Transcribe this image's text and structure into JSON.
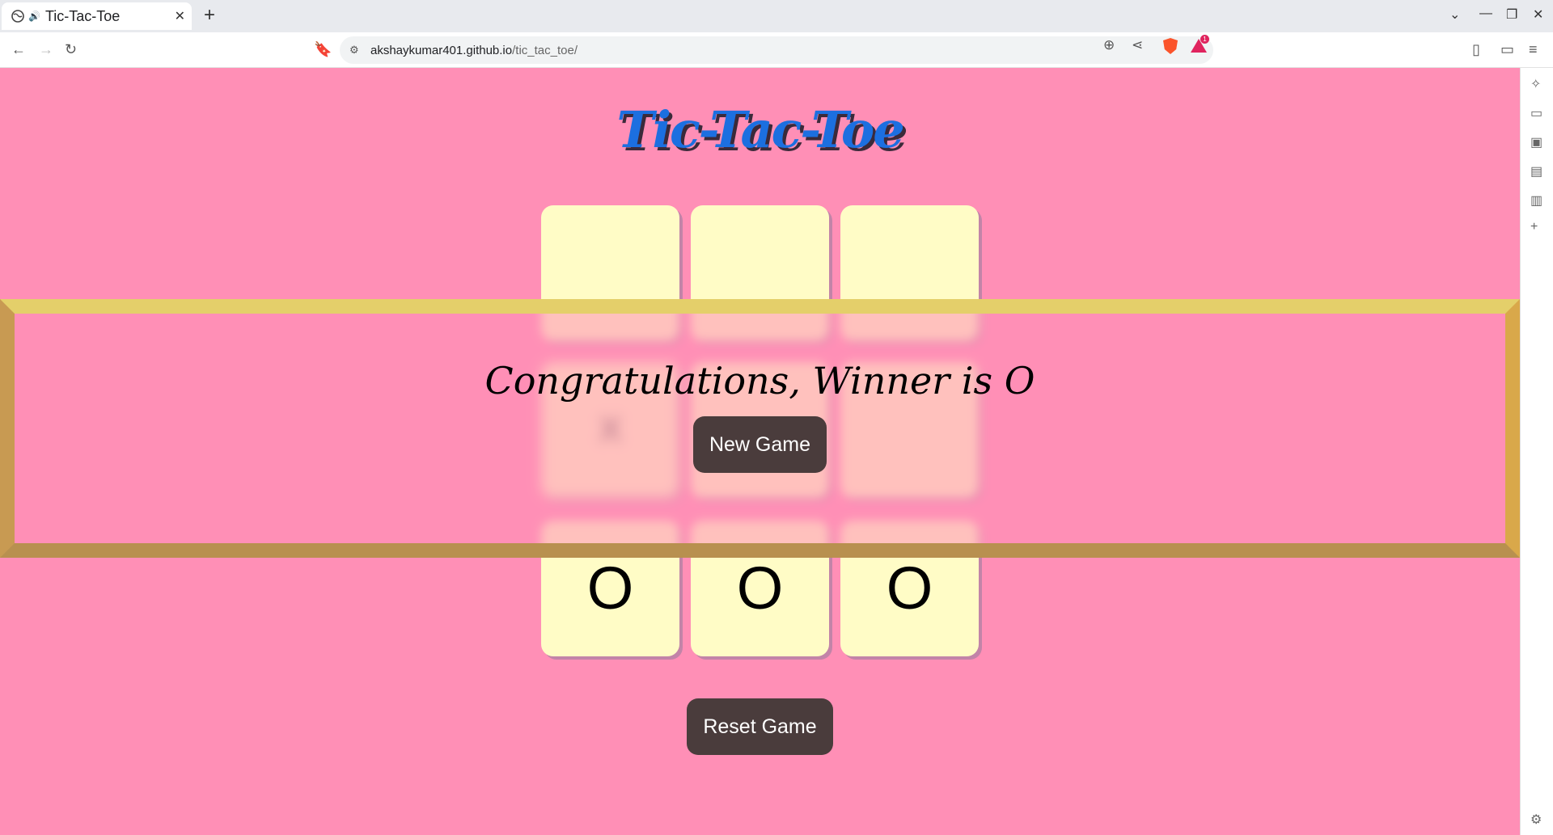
{
  "browser": {
    "tab_title": "Tic-Tac-Toe",
    "url_host": "akshaykumar401.github.io",
    "url_path": "/tic_tac_toe/",
    "rewards_count": "1"
  },
  "game": {
    "title": "Tic-Tac-Toe",
    "cells": [
      "",
      "",
      "",
      "X",
      "",
      "",
      "O",
      "O",
      "O"
    ],
    "winner_message": "Congratulations, Winner is O",
    "new_game_label": "New Game",
    "reset_label": "Reset Game"
  },
  "colors": {
    "background": "#ff8fb6",
    "cell": "#fffcc6",
    "button": "#4a3c3c",
    "title": "#1c6fe0",
    "overlay_border": "#d9a84a"
  }
}
